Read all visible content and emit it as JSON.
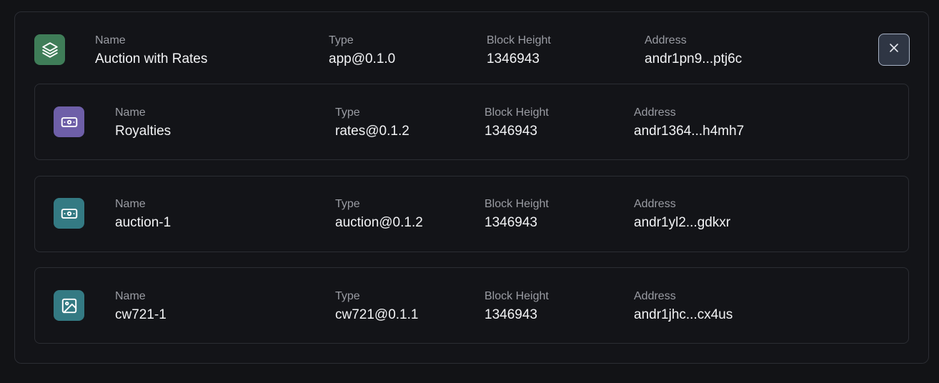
{
  "app": {
    "icon": "layers-icon",
    "icon_color": "#3f7d58",
    "name_label": "Name",
    "name": "Auction with Rates",
    "type_label": "Type",
    "type": "app@0.1.0",
    "block_height_label": "Block Height",
    "block_height": "1346943",
    "address_label": "Address",
    "address": "andr1pn9...ptj6c",
    "close_icon": "close-icon"
  },
  "components": [
    {
      "icon": "banknote-icon",
      "icon_color": "#6e5fa8",
      "name_label": "Name",
      "name": "Royalties",
      "type_label": "Type",
      "type": "rates@0.1.2",
      "block_height_label": "Block Height",
      "block_height": "1346943",
      "address_label": "Address",
      "address": "andr1364...h4mh7"
    },
    {
      "icon": "banknote-icon",
      "icon_color": "#347a83",
      "name_label": "Name",
      "name": "auction-1",
      "type_label": "Type",
      "type": "auction@0.1.2",
      "block_height_label": "Block Height",
      "block_height": "1346943",
      "address_label": "Address",
      "address": "andr1yl2...gdkxr"
    },
    {
      "icon": "image-icon",
      "icon_color": "#347a83",
      "name_label": "Name",
      "name": "cw721-1",
      "type_label": "Type",
      "type": "cw721@0.1.1",
      "block_height_label": "Block Height",
      "block_height": "1346943",
      "address_label": "Address",
      "address": "andr1jhc...cx4us"
    }
  ]
}
